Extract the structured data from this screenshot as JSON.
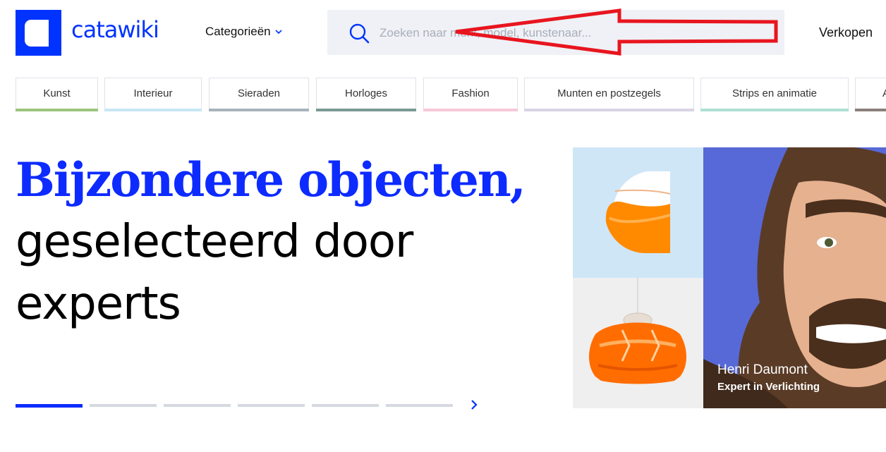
{
  "header": {
    "brand": "catawiki",
    "categories_label": "Categorieën",
    "search_placeholder": "Zoeken naar merk, model, kunstenaar...",
    "sell_label": "Verkopen"
  },
  "category_tabs": [
    {
      "label": "Kunst",
      "color": "#9bc47e"
    },
    {
      "label": "Interieur",
      "color": "#c7e6f4"
    },
    {
      "label": "Sieraden",
      "color": "#a7b4bb"
    },
    {
      "label": "Horloges",
      "color": "#7b9a94"
    },
    {
      "label": "Fashion",
      "color": "#f6c9d8"
    },
    {
      "label": "Munten en postzegels",
      "color": "#d9d4e4"
    },
    {
      "label": "Strips en animatie",
      "color": "#aee0d2"
    },
    {
      "label": "A",
      "color": "#8c7f7c"
    }
  ],
  "hero": {
    "line1": "Bijzondere objecten,",
    "line2": "geselecteerd door",
    "line3": "experts",
    "slide_count": 6,
    "active_slide": 1
  },
  "expert": {
    "name": "Henri Daumont",
    "role": "Expert in Verlichting"
  },
  "colors": {
    "brand_blue": "#0033ff",
    "annotation_red": "#e8151f"
  },
  "icons": {
    "search": "search-icon",
    "dropdown": "chevron-down-icon",
    "next": "chevron-right-icon"
  }
}
